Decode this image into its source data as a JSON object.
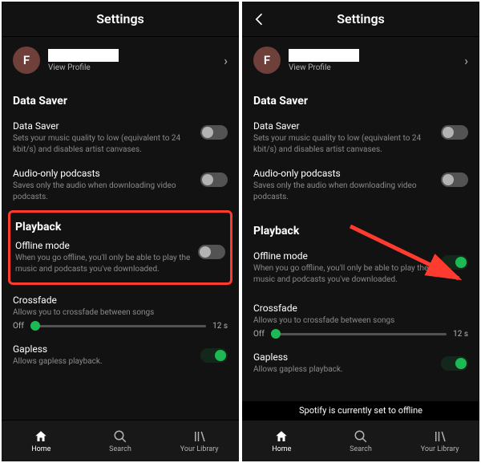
{
  "header": {
    "title": "Settings"
  },
  "profile": {
    "avatar_letter": "F",
    "view_profile": "View Profile"
  },
  "sections": {
    "data_saver_title": "Data Saver",
    "data_saver": {
      "label": "Data Saver",
      "desc": "Sets your music quality to low (equivalent to 24 kbit/s) and disables artist canvases."
    },
    "audio_podcasts": {
      "label": "Audio-only podcasts",
      "desc": "Saves only the audio when downloading video podcasts."
    },
    "playback_title": "Playback",
    "offline": {
      "label": "Offline mode",
      "desc": "When you go offline, you'll only be able to play the music and podcasts you've downloaded."
    },
    "crossfade": {
      "label": "Crossfade",
      "desc": "Allows you to crossfade between songs",
      "min": "Off",
      "max": "12 s"
    },
    "gapless": {
      "label": "Gapless",
      "desc": "Allows gapless playback."
    }
  },
  "nav": {
    "home": "Home",
    "search": "Search",
    "library": "Your Library"
  },
  "toast": "Spotify is currently set to offline"
}
